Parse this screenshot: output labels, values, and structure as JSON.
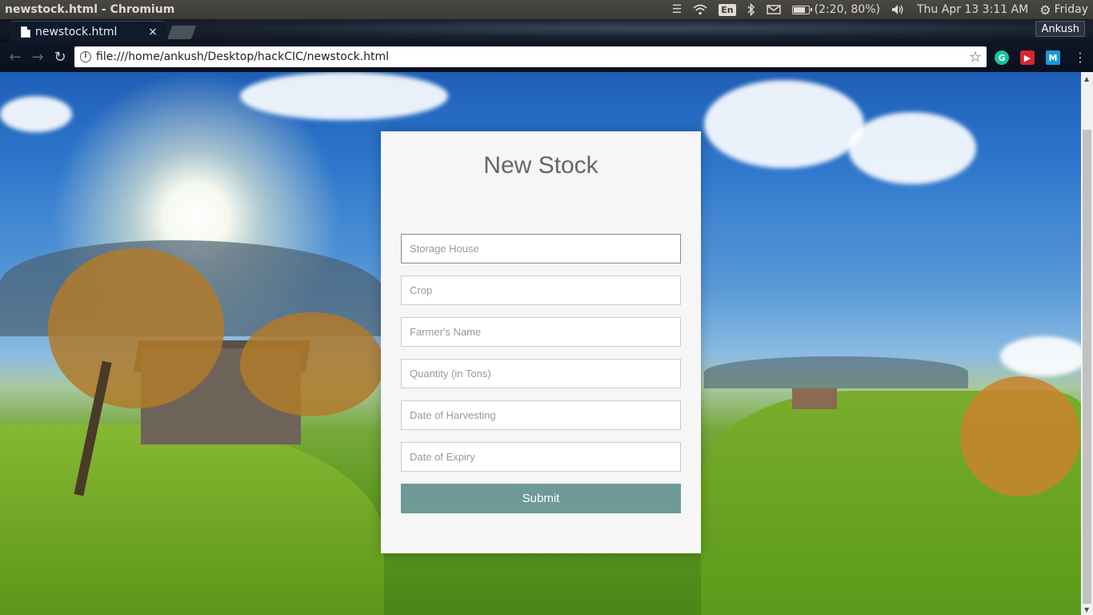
{
  "os_panel": {
    "window_title": "newstock.html - Chromium",
    "language": "En",
    "battery": "(2:20, 80%)",
    "clock": "Thu Apr 13  3:11 AM",
    "session": "Friday"
  },
  "browser": {
    "tab_title": "newstock.html",
    "tab_close": "×",
    "profile_name": "Ankush",
    "url": "file:///home/ankush/Desktop/hackCIC/newstock.html",
    "extensions": [
      "G",
      "▶",
      "M"
    ]
  },
  "form": {
    "title": "New Stock",
    "fields": [
      {
        "placeholder": "Storage House",
        "value": ""
      },
      {
        "placeholder": "Crop",
        "value": ""
      },
      {
        "placeholder": "Farmer's Name",
        "value": ""
      },
      {
        "placeholder": "Quantity (in Tons)",
        "value": ""
      },
      {
        "placeholder": "Date of Harvesting",
        "value": ""
      },
      {
        "placeholder": "Date of Expiry",
        "value": ""
      }
    ],
    "submit_label": "Submit"
  },
  "colors": {
    "submit_bg": "#6e9a97",
    "card_bg": "#f6f6f6"
  }
}
